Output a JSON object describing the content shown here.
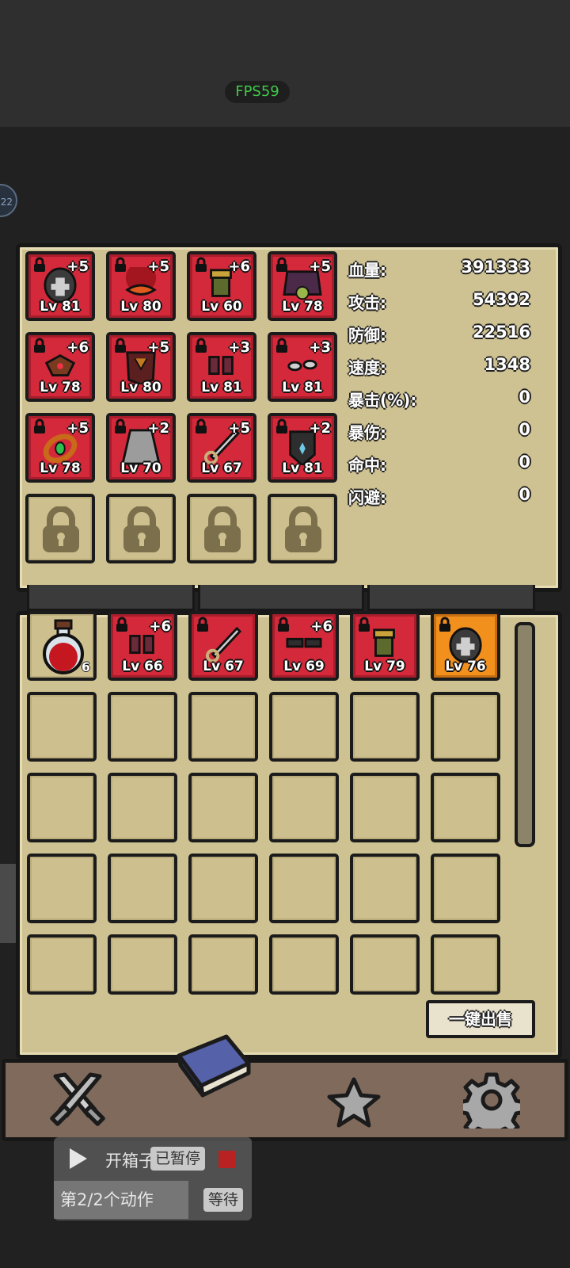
{
  "status_bar": {
    "fps": "FPS59"
  },
  "side_badge": "22",
  "equipped": [
    {
      "name": "helmet",
      "level": "Lv 81",
      "plus": "+5"
    },
    {
      "name": "mask",
      "level": "Lv 80",
      "plus": "+5"
    },
    {
      "name": "gloves",
      "level": "Lv 60",
      "plus": "+6"
    },
    {
      "name": "armor",
      "level": "Lv 78",
      "plus": "+5"
    },
    {
      "name": "amulet",
      "level": "Lv 78",
      "plus": "+6"
    },
    {
      "name": "cape",
      "level": "Lv 80",
      "plus": "+5"
    },
    {
      "name": "boots",
      "level": "Lv 81",
      "plus": "+3"
    },
    {
      "name": "earrings",
      "level": "Lv 81",
      "plus": "+3"
    },
    {
      "name": "ring",
      "level": "Lv 78",
      "plus": "+5"
    },
    {
      "name": "skirt",
      "level": "Lv 70",
      "plus": "+2"
    },
    {
      "name": "sword",
      "level": "Lv 67",
      "plus": "+5"
    },
    {
      "name": "shield",
      "level": "Lv 81",
      "plus": "+2"
    }
  ],
  "stats": [
    {
      "label": "血量:",
      "value": "391333"
    },
    {
      "label": "攻击:",
      "value": "54392"
    },
    {
      "label": "防御:",
      "value": "22516"
    },
    {
      "label": "速度:",
      "value": "1348"
    },
    {
      "label": "暴击(%):",
      "value": "0"
    },
    {
      "label": "暴伤:",
      "value": "0"
    },
    {
      "label": "命中:",
      "value": "0"
    },
    {
      "label": "闪避:",
      "value": "0"
    }
  ],
  "inventory": [
    {
      "name": "potion",
      "count": "6"
    },
    {
      "name": "boots",
      "level": "Lv 66",
      "plus": "+6"
    },
    {
      "name": "sword",
      "level": "Lv 67",
      "plus": ""
    },
    {
      "name": "bracers",
      "level": "Lv 69",
      "plus": "+6"
    },
    {
      "name": "gloves",
      "level": "Lv 79",
      "plus": ""
    },
    {
      "name": "helmet",
      "level": "Lv 76",
      "plus": ""
    }
  ],
  "sell_all": "一键出售",
  "nav": [
    "swords-icon",
    "book-icon",
    "star-icon",
    "gear-icon"
  ],
  "overlay": {
    "title": "开箱子",
    "paused": "已暂停",
    "step": "第2/2个动作",
    "wait": "等待"
  },
  "colors": {
    "rare": "#d4293a",
    "legendary": "#f2901e",
    "parchment": "#cfc292"
  }
}
